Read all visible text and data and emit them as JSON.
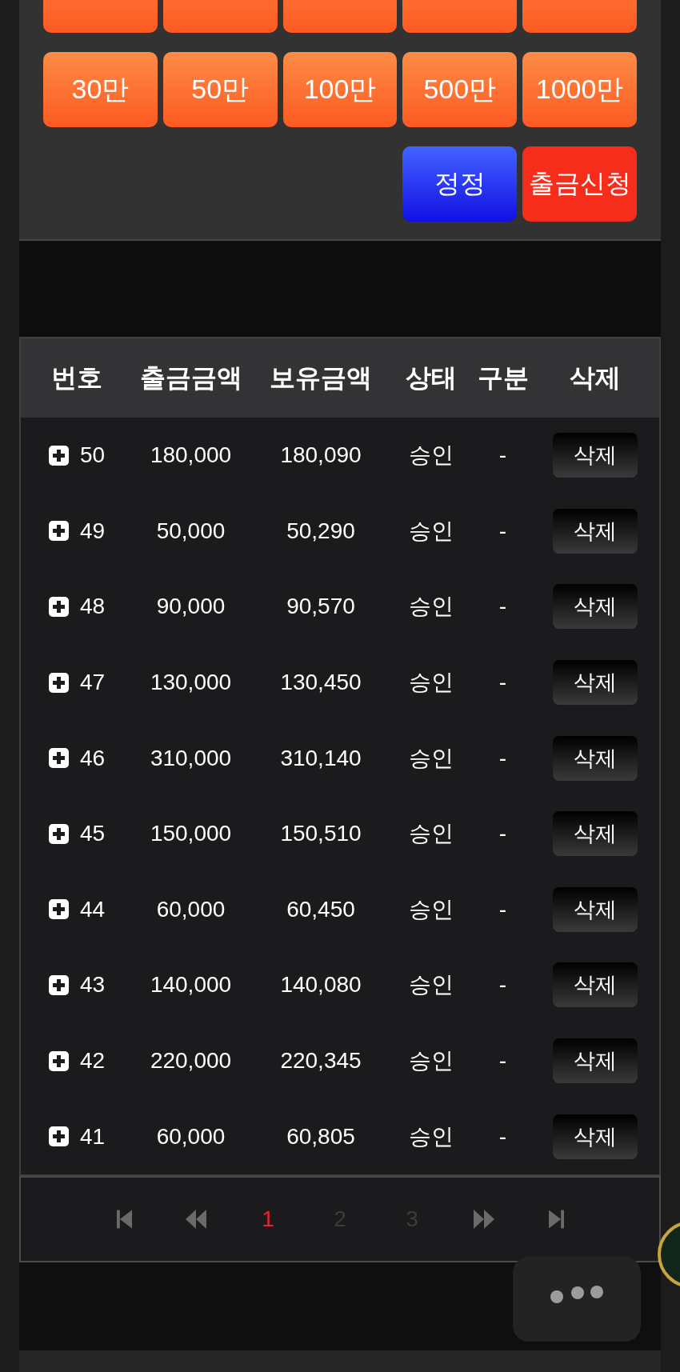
{
  "amount_panel": {
    "cut_row": [
      {
        "kind": "amount"
      },
      {
        "kind": "amount"
      },
      {
        "kind": "amount"
      },
      {
        "kind": "amount"
      },
      {
        "kind": "amount"
      }
    ],
    "amount_buttons": [
      {
        "label": "30만"
      },
      {
        "label": "50만"
      },
      {
        "label": "100만"
      },
      {
        "label": "500만"
      },
      {
        "label": "1000만"
      }
    ],
    "actions": [
      {
        "label": "정정",
        "kind": "reset"
      },
      {
        "label": "출금신청",
        "kind": "submit"
      }
    ]
  },
  "table": {
    "columns": [
      "번호",
      "출금금액",
      "보유금액",
      "상태",
      "구분",
      "삭제"
    ],
    "rows": [
      {
        "expanded": false,
        "number": "50",
        "withdrawal": "180,000",
        "balance": "180,090",
        "status": "승인",
        "category": "-",
        "action": "삭제"
      },
      {
        "expanded": false,
        "number": "49",
        "withdrawal": "50,000",
        "balance": "50,290",
        "status": "승인",
        "category": "-",
        "action": "삭제"
      },
      {
        "expanded": false,
        "number": "48",
        "withdrawal": "90,000",
        "balance": "90,570",
        "status": "승인",
        "category": "-",
        "action": "삭제"
      },
      {
        "expanded": false,
        "number": "47",
        "withdrawal": "130,000",
        "balance": "130,450",
        "status": "승인",
        "category": "-",
        "action": "삭제"
      },
      {
        "expanded": false,
        "number": "46",
        "withdrawal": "310,000",
        "balance": "310,140",
        "status": "승인",
        "category": "-",
        "action": "삭제"
      },
      {
        "expanded": false,
        "number": "45",
        "withdrawal": "150,000",
        "balance": "150,510",
        "status": "승인",
        "category": "-",
        "action": "삭제"
      },
      {
        "expanded": false,
        "number": "44",
        "withdrawal": "60,000",
        "balance": "60,450",
        "status": "승인",
        "category": "-",
        "action": "삭제"
      },
      {
        "expanded": false,
        "number": "43",
        "withdrawal": "140,000",
        "balance": "140,080",
        "status": "승인",
        "category": "-",
        "action": "삭제"
      },
      {
        "expanded": false,
        "number": "42",
        "withdrawal": "220,000",
        "balance": "220,345",
        "status": "승인",
        "category": "-",
        "action": "삭제"
      },
      {
        "expanded": false,
        "number": "41",
        "withdrawal": "60,000",
        "balance": "60,805",
        "status": "승인",
        "category": "-",
        "action": "삭제"
      }
    ]
  },
  "pagination": {
    "items": [
      {
        "kind": "first"
      },
      {
        "kind": "prev"
      },
      {
        "kind": "page",
        "label": "1",
        "selected": true
      },
      {
        "kind": "page",
        "label": "2",
        "selected": false
      },
      {
        "kind": "page",
        "label": "3",
        "selected": false
      },
      {
        "kind": "next"
      },
      {
        "kind": "last"
      }
    ]
  }
}
